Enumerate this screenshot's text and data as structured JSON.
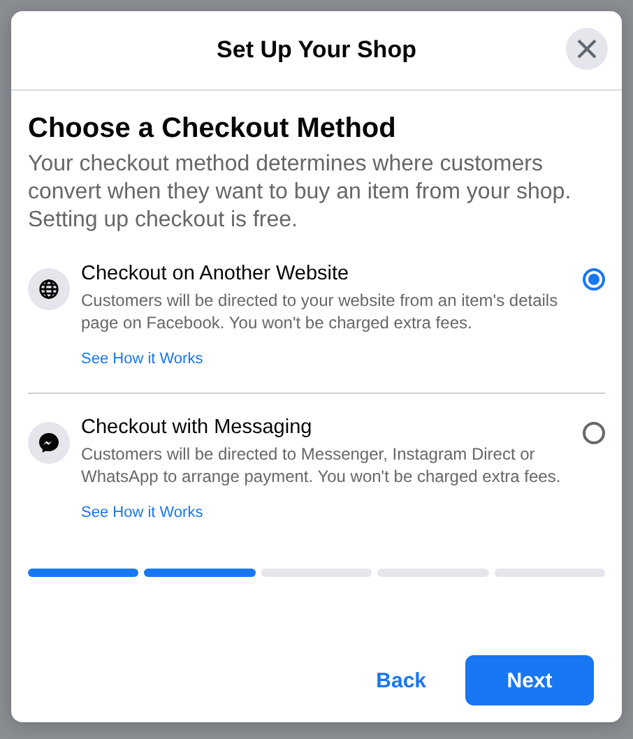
{
  "dialog": {
    "title": "Set Up Your Shop"
  },
  "heading": "Choose a Checkout Method",
  "description": "Your checkout method determines where customers convert when they want to buy an item from your shop. Setting up checkout is free.",
  "options": [
    {
      "kind": "globe",
      "title": "Checkout on Another Website",
      "text": "Customers will be directed to your website from an item's details page on Facebook. You won't be charged extra fees.",
      "link": "See How it Works",
      "selected": true
    },
    {
      "kind": "messenger",
      "title": "Checkout with Messaging",
      "text": "Customers will be directed to Messenger, Instagram Direct or WhatsApp to arrange payment. You won't be charged extra fees.",
      "link": "See How it Works",
      "selected": false
    }
  ],
  "steps": [
    {
      "done": true
    },
    {
      "done": true
    },
    {
      "done": false
    },
    {
      "done": false
    },
    {
      "done": false
    }
  ],
  "buttons": {
    "back": "Back",
    "next": "Next"
  }
}
